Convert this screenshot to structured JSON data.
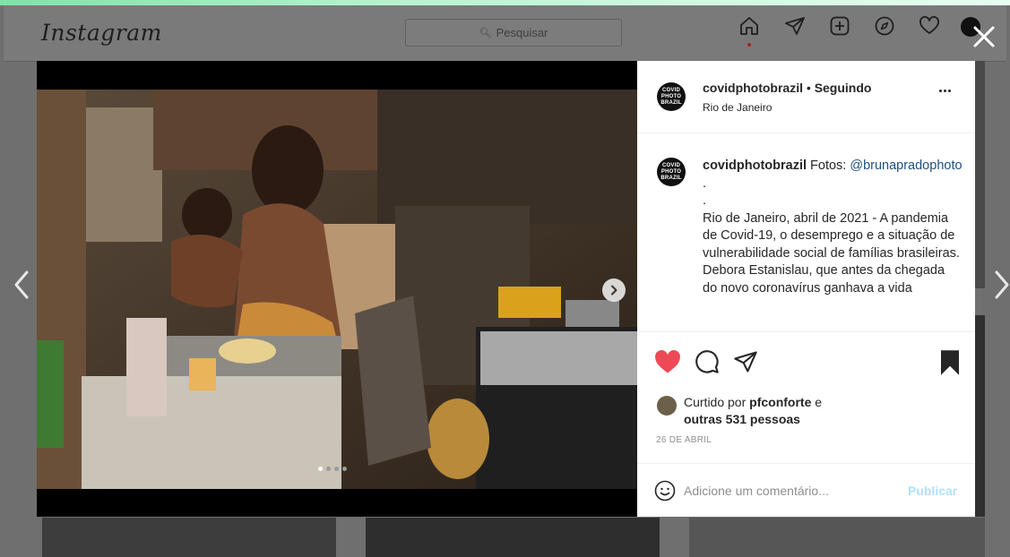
{
  "header": {
    "logo": "Instagram",
    "search_placeholder": "Pesquisar",
    "icons": [
      "home-icon",
      "direct-icon",
      "new-post-icon",
      "explore-icon",
      "activity-icon",
      "profile-avatar"
    ]
  },
  "modal": {
    "close_icon": "close-icon",
    "prev_arrow": "chevron-left-icon",
    "next_arrow": "chevron-right-icon",
    "carousel": {
      "slide_count": 4,
      "active_index": 0
    }
  },
  "post": {
    "badge_text": "COVID PHOTO BRAZIL",
    "username": "covidphotobrazil",
    "separator": "•",
    "follow_status": "Seguindo",
    "location": "Rio de Janeiro",
    "caption": {
      "username": "covidphotobrazil",
      "intro": " Fotos: ",
      "mention": "@brunapradophoto",
      "lines": [
        ".",
        ".",
        "Rio de Janeiro, abril de 2021 - A pandemia de Covid-19, o desemprego e a situação de vulnerabilidade social de famílias brasileiras.",
        "Debora Estanislau, que antes da chegada do novo coronavírus ganhava a vida"
      ]
    },
    "likes": {
      "prefix": "Curtido por ",
      "user": "pfconforte",
      "mid": " e",
      "others": "outras 531 pessoas"
    },
    "date": "26 DE ABRIL",
    "comment_placeholder": "Adicione um comentário...",
    "publish_label": "Publicar"
  },
  "colors": {
    "like_red": "#ed4956",
    "link_blue": "#1d4f7e",
    "publish_disabled": "#b2dffc"
  }
}
